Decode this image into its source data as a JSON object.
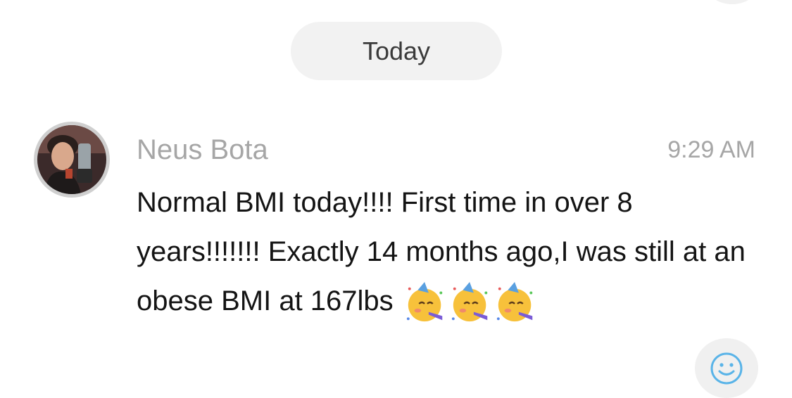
{
  "date_divider": {
    "label": "Today"
  },
  "message": {
    "sender": "Neus Bota",
    "time": "9:29 AM",
    "text": "Normal BMI today!!!! First time in over 8 years!!!!!!! Exactly 14 months ago,I was still at an obese BMI at 167lbs",
    "emoji_names": [
      "partying-face",
      "partying-face",
      "partying-face"
    ]
  },
  "reaction_button": {
    "icon": "smiley-icon"
  },
  "colors": {
    "pill_bg": "#f2f2f2",
    "muted_text": "#a6a6a6",
    "body_text": "#141414",
    "smiley_blue": "#5ab4e8",
    "emoji_yellow": "#f7c13b"
  }
}
